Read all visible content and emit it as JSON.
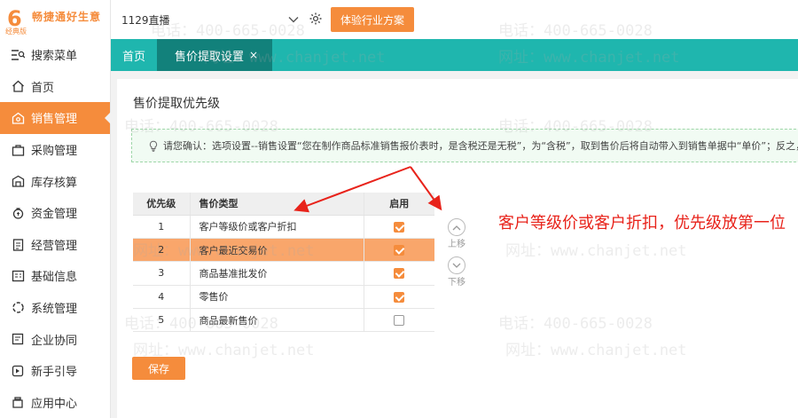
{
  "brand": {
    "logo_glyph": "6",
    "name": "畅捷通好生意",
    "edition": "经典版"
  },
  "sidebar": {
    "items": [
      {
        "label": "搜索菜单",
        "icon": "search-menu-icon"
      },
      {
        "label": "首页",
        "icon": "home-icon"
      },
      {
        "label": "销售管理",
        "icon": "sales-icon",
        "active": true
      },
      {
        "label": "采购管理",
        "icon": "purchase-icon"
      },
      {
        "label": "库存核算",
        "icon": "inventory-icon"
      },
      {
        "label": "资金管理",
        "icon": "funds-icon"
      },
      {
        "label": "经营管理",
        "icon": "business-icon"
      },
      {
        "label": "基础信息",
        "icon": "basic-info-icon"
      },
      {
        "label": "系统管理",
        "icon": "system-icon"
      },
      {
        "label": "企业协同",
        "icon": "collaboration-icon"
      },
      {
        "label": "新手引导",
        "icon": "guide-icon"
      },
      {
        "label": "应用中心",
        "icon": "app-center-icon"
      }
    ]
  },
  "topbar": {
    "account": "1129直播",
    "trial_button": "体验行业方案"
  },
  "tabs": [
    {
      "label": "首页"
    },
    {
      "label": "售价提取设置",
      "close": "×",
      "active": true
    }
  ],
  "page": {
    "title": "售价提取优先级",
    "notice": "请您确认：选项设置--销售设置“您在制作商品标准销售报价表时，是含税还是无税”，为“含税”，取到售价后将自动带入到销售单据中“单价”；反之，带入到“无",
    "table": {
      "headers": [
        "优先级",
        "售价类型",
        "启用"
      ],
      "rows": [
        {
          "priority": "1",
          "type": "客户等级价或客户折扣",
          "enabled": true
        },
        {
          "priority": "2",
          "type": "客户最近交易价",
          "enabled": true,
          "selected": true
        },
        {
          "priority": "3",
          "type": "商品基准批发价",
          "enabled": true
        },
        {
          "priority": "4",
          "type": "零售价",
          "enabled": true
        },
        {
          "priority": "5",
          "type": "商品最新售价",
          "enabled": false
        }
      ]
    },
    "move_up": "上移",
    "move_down": "下移",
    "save": "保存"
  },
  "annotation": "客户等级价或客户折扣，优先级放第一位",
  "watermark": {
    "phone": "电话：400-665-0028",
    "site": "网址：www.chanjet.net"
  },
  "colors": {
    "accent": "#f58c3c",
    "teal": "#1fb6ae",
    "teal_dark": "#12817b",
    "annotation_red": "#e8231b"
  }
}
